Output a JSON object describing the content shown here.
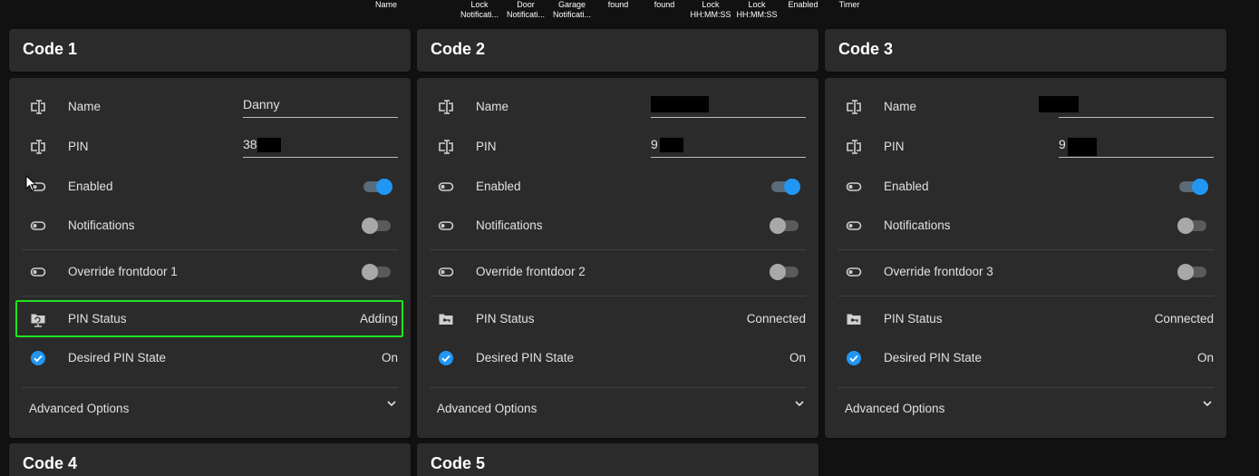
{
  "table_header": {
    "columns": [
      {
        "label": "Name"
      },
      {
        "label": "Lock\nNotificati..."
      },
      {
        "label": "Door\nNotificati..."
      },
      {
        "label": "Garage\nNotificati..."
      },
      {
        "label": "found"
      },
      {
        "label": "found"
      },
      {
        "label": "Lock\nHH:MM:SS"
      },
      {
        "label": "Lock\nHH:MM:SS"
      },
      {
        "label": "Enabled"
      },
      {
        "label": "Timer"
      }
    ]
  },
  "codes": [
    {
      "title": "Code 1",
      "name_label": "Name",
      "name_value": "Danny",
      "pin_label": "PIN",
      "pin_value": "38",
      "enabled_label": "Enabled",
      "enabled": true,
      "notifications_label": "Notifications",
      "notifications": false,
      "override_label": "Override frontdoor 1",
      "override": false,
      "pin_status_label": "PIN Status",
      "pin_status": "Adding",
      "desired_label": "Desired PIN State",
      "desired_value": "On",
      "advanced_label": "Advanced Options"
    },
    {
      "title": "Code 2",
      "name_label": "Name",
      "name_value": "",
      "pin_label": "PIN",
      "pin_value": "9",
      "enabled_label": "Enabled",
      "enabled": true,
      "notifications_label": "Notifications",
      "notifications": false,
      "override_label": "Override frontdoor 2",
      "override": false,
      "pin_status_label": "PIN Status",
      "pin_status": "Connected",
      "desired_label": "Desired PIN State",
      "desired_value": "On",
      "advanced_label": "Advanced Options"
    },
    {
      "title": "Code 3",
      "name_label": "Name",
      "name_value": "",
      "pin_label": "PIN",
      "pin_value": "9",
      "enabled_label": "Enabled",
      "enabled": true,
      "notifications_label": "Notifications",
      "notifications": false,
      "override_label": "Override frontdoor 3",
      "override": false,
      "pin_status_label": "PIN Status",
      "pin_status": "Connected",
      "desired_label": "Desired PIN State",
      "desired_value": "On",
      "advanced_label": "Advanced Options"
    }
  ],
  "lower_cards": [
    {
      "title": "Code 4"
    },
    {
      "title": "Code 5"
    }
  ],
  "colors": {
    "accent": "#2196f3",
    "highlight": "#1ee31e",
    "card": "#2b2b2b",
    "background": "#111111"
  }
}
